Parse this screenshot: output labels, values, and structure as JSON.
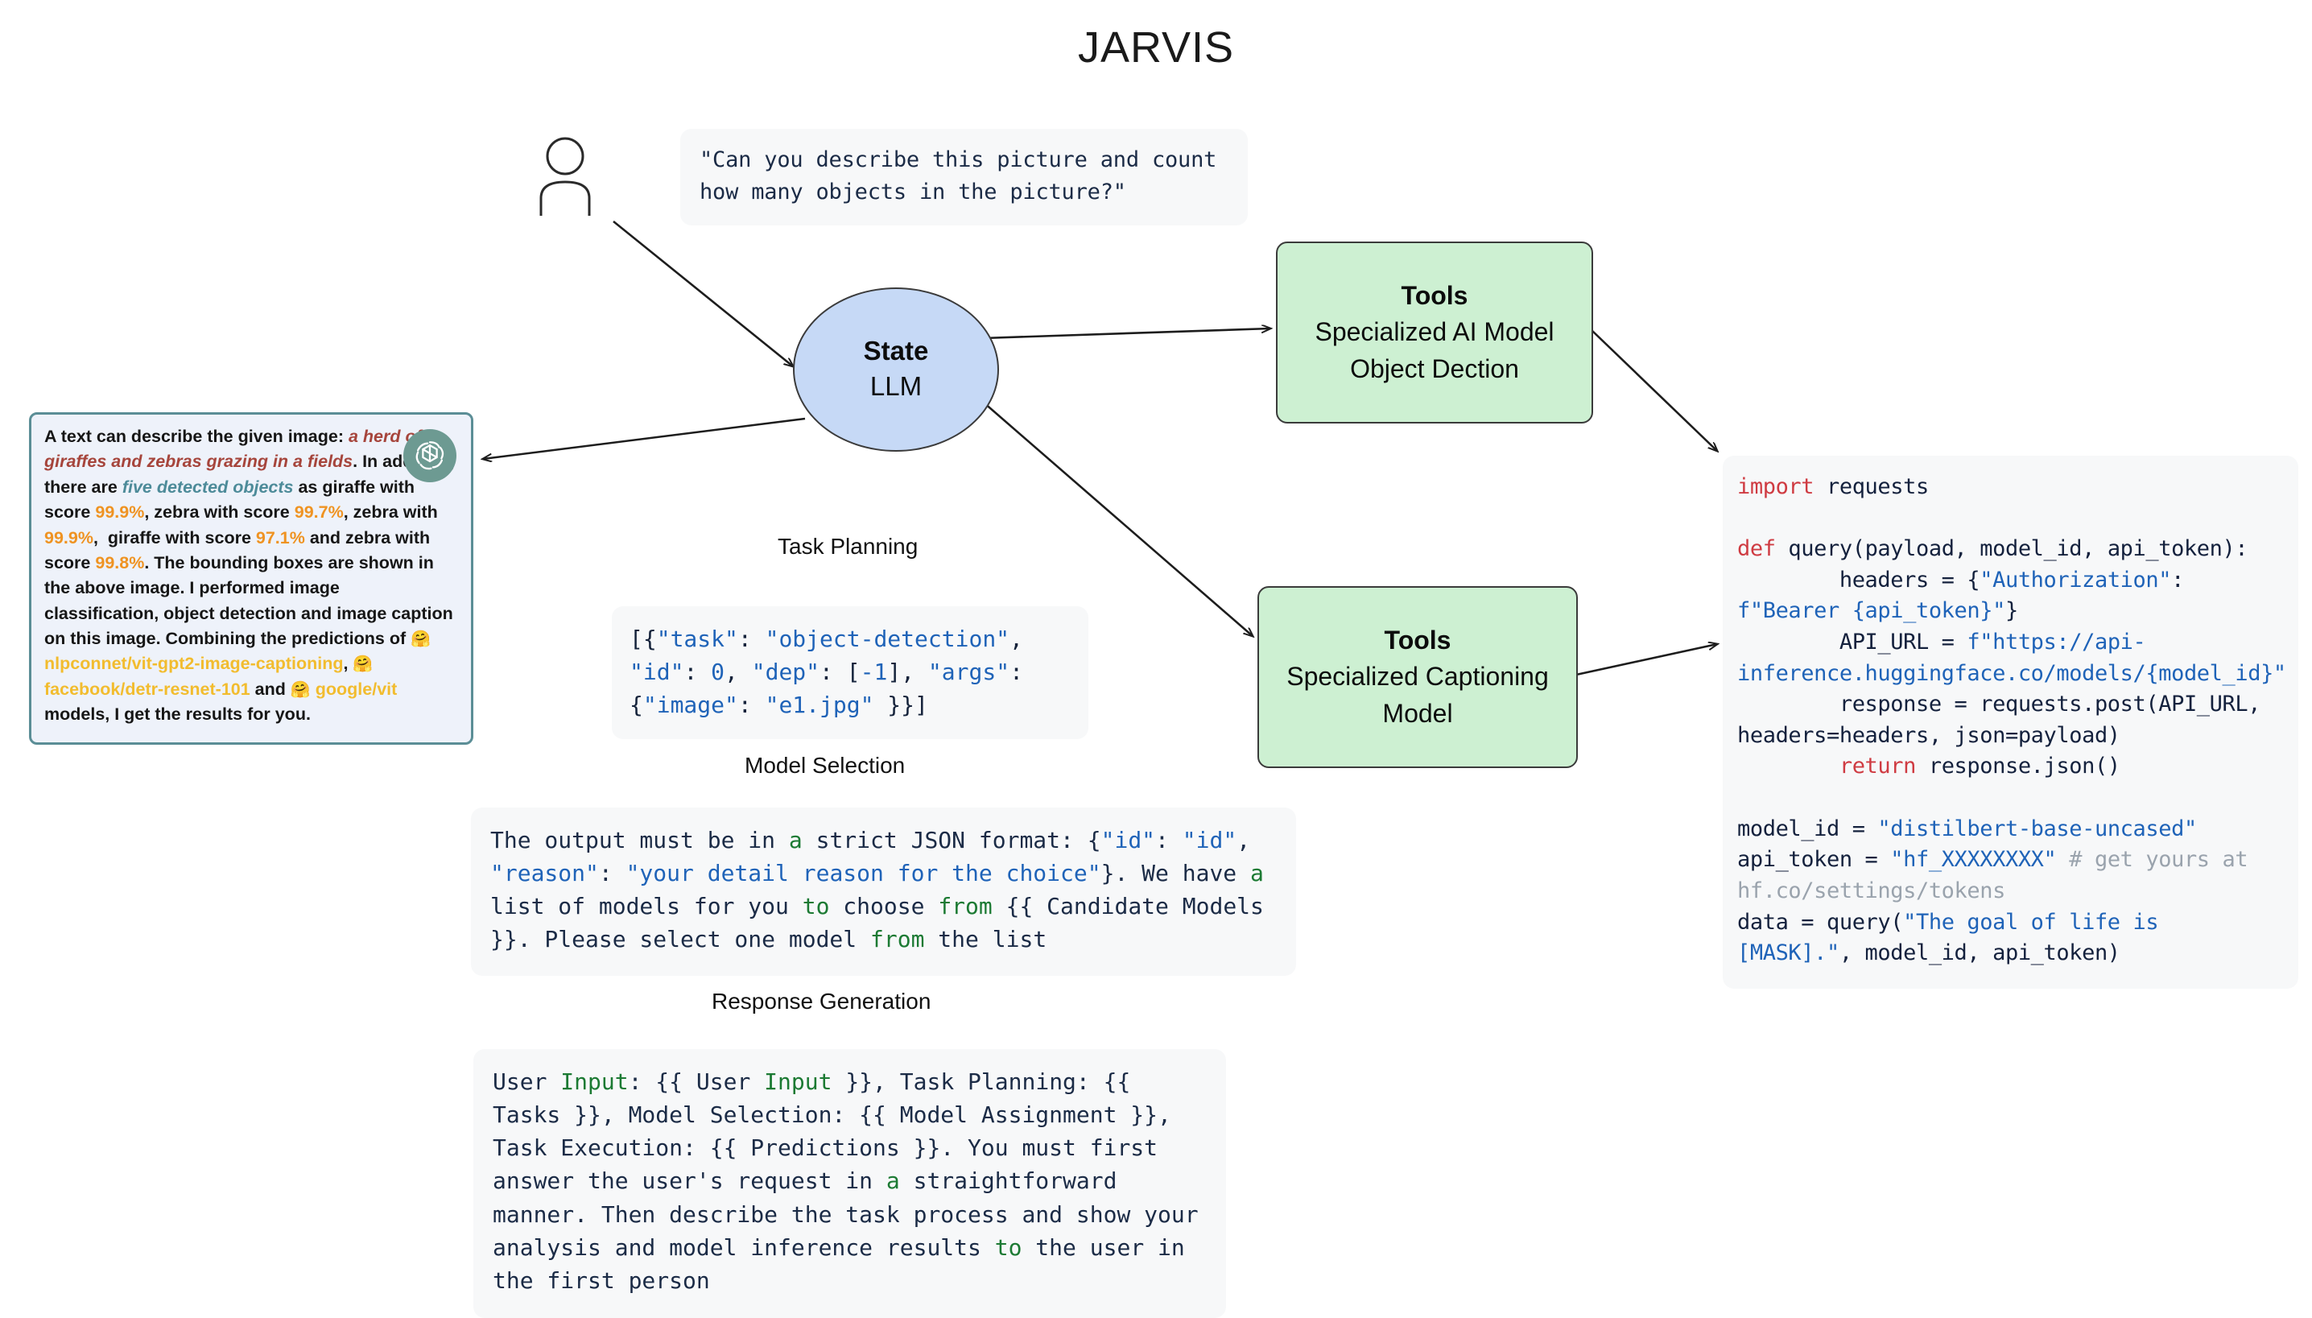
{
  "title": "JARVIS",
  "user": {
    "icon": "person-icon",
    "query": "\"Can you describe this picture and count how many objects in the picture?\""
  },
  "state_node": {
    "title": "State",
    "subtitle": "LLM"
  },
  "tools": [
    {
      "header": "Tools",
      "line1": "Specialized AI Model",
      "line2": "Object Dection"
    },
    {
      "header": "Tools",
      "line1": "Specialized Captioning",
      "line2": "Model"
    }
  ],
  "sections": {
    "task_planning": {
      "label": "Task Planning",
      "text": "[{\"task\": \"object-detection\", \"id\": 0, \"dep\": [-1], \"args\": {\"image\": \"e1.jpg\" }}]"
    },
    "model_selection": {
      "label": "Model Selection",
      "text": "The output must be in a strict JSON format: {\"id\": \"id\", \"reason\": \"your detail reason for the choice\"}. We have a list of models for you to choose from {{ Candidate Models }}. Please select one model from the list"
    },
    "response_generation": {
      "label": "Response Generation",
      "text": "User Input: {{ User Input }}, Task Planning: {{ Tasks }}, Model Selection: {{ Model Assignment }}, Task Execution: {{ Predictions }}. You must first answer the user's request in a straightforward manner. Then describe the task process and show your analysis and model inference results to the user in the first person"
    }
  },
  "code_panel": {
    "language": "python",
    "text": "import requests\n\ndef query(payload, model_id, api_token):\n\theaders = {\"Authorization\": f\"Bearer {api_token}\"}\n\tAPI_URL = f\"https://api-inference.huggingface.co/models/{model_id}\"\n\tresponse = requests.post(API_URL, headers=headers, json=payload)\n\treturn response.json()\n\nmodel_id = \"distilbert-base-uncased\"\napi_token = \"hf_XXXXXXXX\" # get yours at hf.co/settings/tokens\ndata = query(\"The goal of life is [MASK].\", model_id, api_token)",
    "model_id": "distilbert-base-uncased",
    "api_token": "hf_XXXXXXXX",
    "comment": "# get yours at hf.co/settings/tokens",
    "query_string": "The goal of life is [MASK]."
  },
  "response_card": {
    "badge": "openai-logo-icon",
    "text": "A text can describe the given image: a herd of giraffes and zebras grazing in a fields. In addition, there are five detected objects as giraffe with score 99.9%, zebra with score 99.7%, zebra with 99.9%,  giraffe with score 97.1% and zebra with score 99.8%. The bounding boxes are shown in the above image. I performed image classification, object detection and image caption on this image. Combining the predictions of 🤗 nlpconnet/vit-gpt2-image-captioning, 🤗 facebook/detr-resnet-101 and 🤗 google/vit models, I get the results for you.",
    "caption": "a herd of giraffes and zebras grazing in a fields",
    "detected_objects_phrase": "five detected objects",
    "scores": [
      "99.9%",
      "99.7%",
      "99.9%",
      "97.1%",
      "99.8%"
    ],
    "models": [
      "nlpconnet/vit-gpt2-image-captioning",
      "facebook/detr-resnet-101",
      "google/vit"
    ]
  },
  "colors": {
    "state_fill": "#c6d9f6",
    "tool_fill": "#cdf0d2",
    "bubble_bg": "#f7f8f9",
    "mono_text": "#1b2b46",
    "code_keyword": "#cf3b42",
    "code_string": "#1f63b8",
    "code_comment": "#9aa3ad",
    "caption_red": "#a6453c",
    "objects_teal": "#4d8b99",
    "score_orange": "#ef9322",
    "model_gold": "#f2bc2e",
    "card_border": "#5b8e96",
    "card_bg": "#eef2fa",
    "badge_green": "#6d9a92"
  }
}
